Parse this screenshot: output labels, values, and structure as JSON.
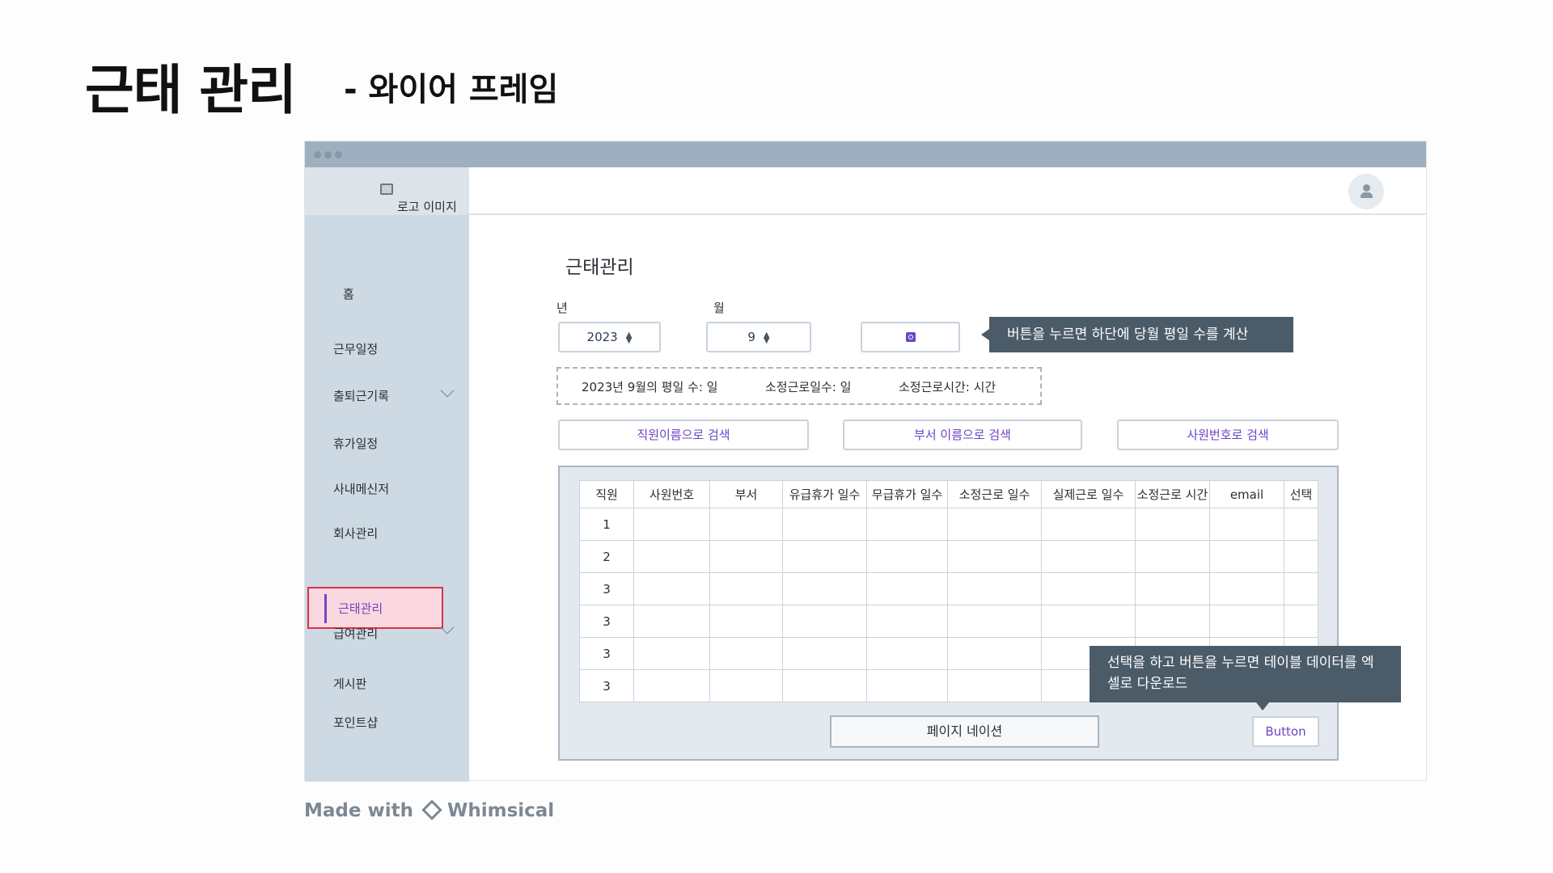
{
  "slide": {
    "title": "근태 관리",
    "subtitle": "- 와이어 프레임"
  },
  "header": {
    "logo_text": "로고 이미지"
  },
  "sidebar": {
    "items": [
      {
        "label": "홈"
      },
      {
        "label": "근무일정"
      },
      {
        "label": "출퇴근기록"
      },
      {
        "label": "휴가일정"
      },
      {
        "label": "사내메신저"
      },
      {
        "label": "회사관리"
      },
      {
        "label": "근태관리"
      },
      {
        "label": "급여관리"
      },
      {
        "label": "게시판"
      },
      {
        "label": "포인트샵"
      }
    ]
  },
  "main": {
    "title": "근태관리",
    "year_label": "년",
    "month_label": "월",
    "year_value": "2023",
    "month_value": "9",
    "tooltip_calc": "버튼을 누르면 하단에 당월 평일 수를 계산",
    "info": {
      "weekdays": "2023년 9월의 평일 수: 일",
      "work_days": "소정근로일수: 일",
      "work_hours": "소정근로시간: 시간"
    },
    "filters": {
      "by_name": "직원이름으로 검색",
      "by_dept": "부서 이름으로 검색",
      "by_id": "사원번호로 검색"
    },
    "table": {
      "columns": [
        "직원",
        "사원번호",
        "부서",
        "유급휴가 일수",
        "무급휴가 일수",
        "소정근로 일수",
        "실제근로 일수",
        "소정근로 시간",
        "email",
        "선택"
      ],
      "rows": [
        "1",
        "2",
        "3",
        "3",
        "3",
        "3"
      ]
    },
    "pagination": "페이지 네이션",
    "button": "Button",
    "tooltip_download": "선택을 하고 버튼을 누르면 테이블 데이터를 엑셀로 다운로드"
  },
  "footer": {
    "made_with": "Made with",
    "brand": "Whimsical"
  }
}
